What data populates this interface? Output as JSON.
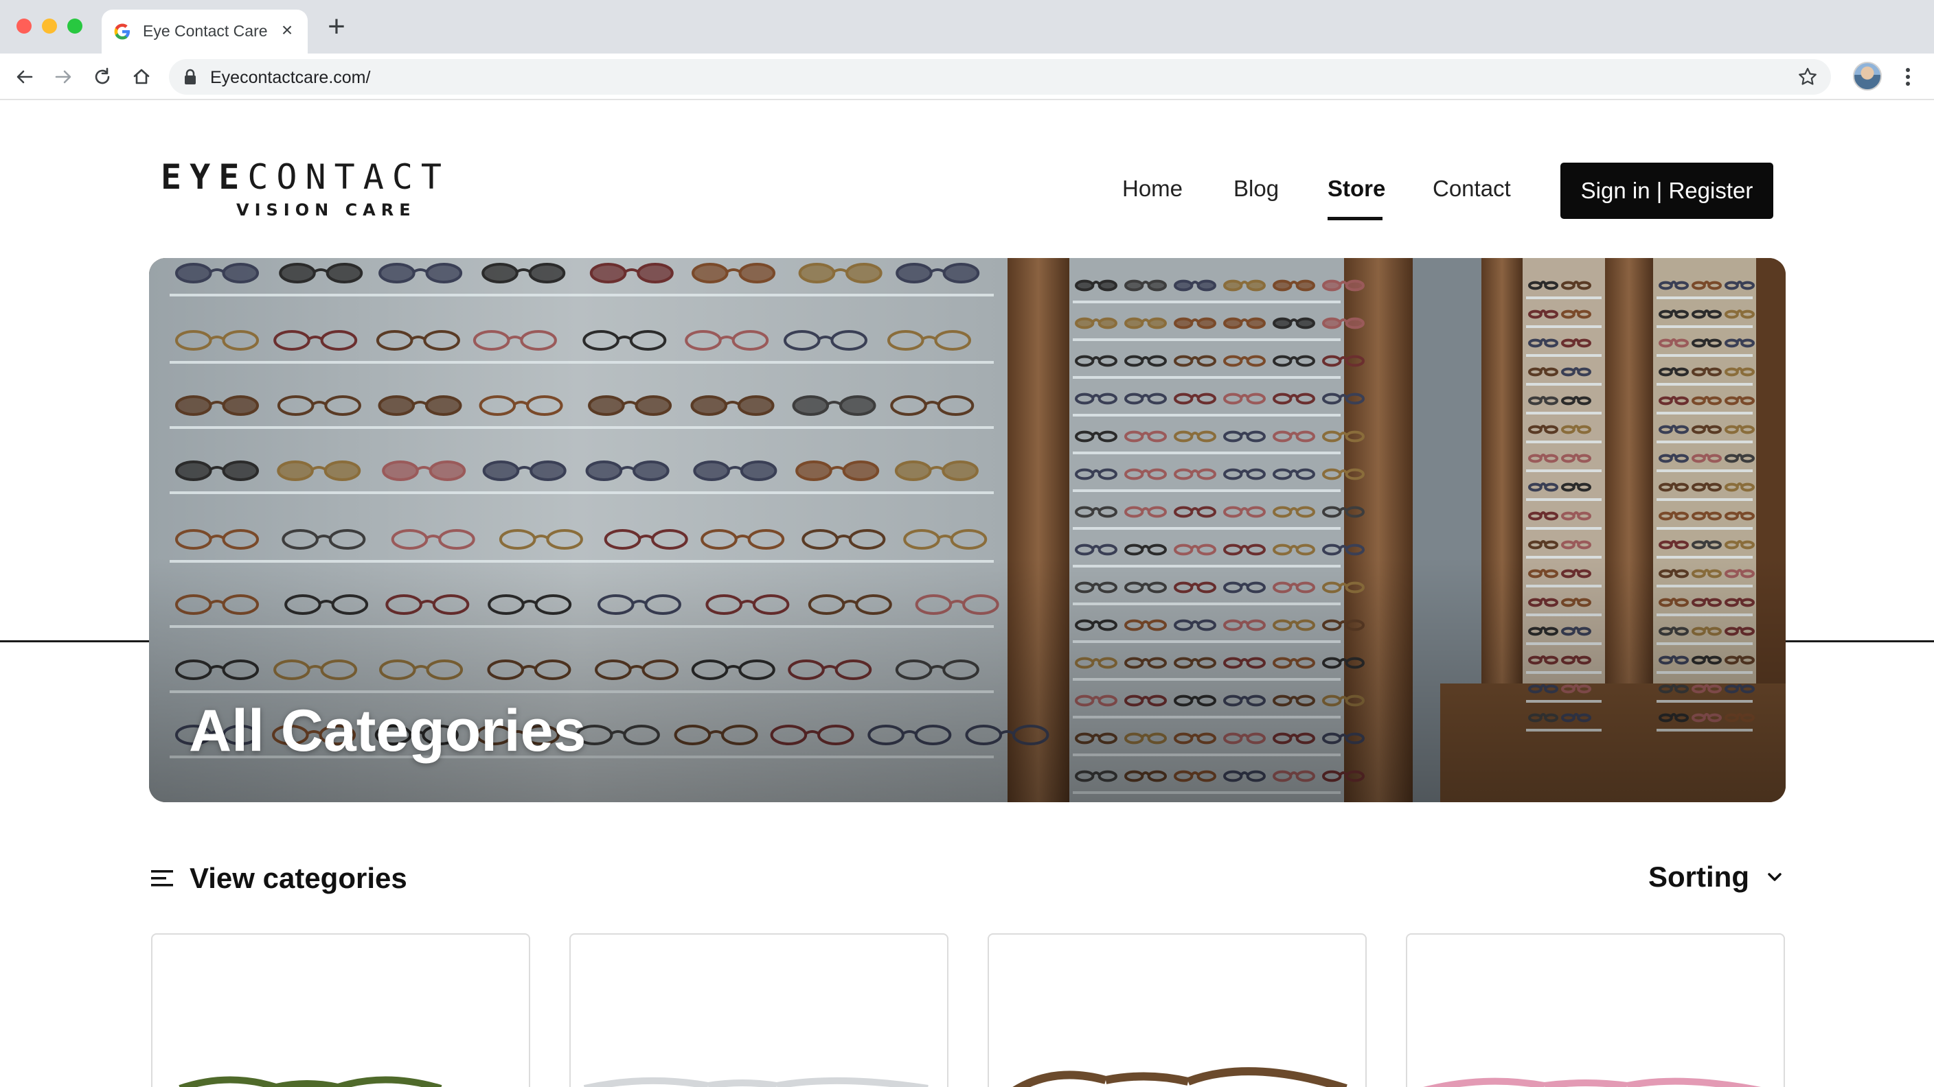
{
  "browser": {
    "tab_title": "Eye Contact Care",
    "tab_close": "×",
    "new_tab": "+",
    "url": "Eyecontactcare.com/"
  },
  "site": {
    "logo": {
      "word1": "EYE",
      "word2": "CONTACT",
      "sub": "VISION CARE"
    },
    "nav": [
      {
        "label": "Home",
        "active": false
      },
      {
        "label": "Blog",
        "active": false
      },
      {
        "label": "Store",
        "active": true
      },
      {
        "label": "Contact",
        "active": false
      }
    ],
    "signin_label": "Sign in | Register"
  },
  "hero": {
    "title": "All Categories"
  },
  "filters": {
    "view_categories": "View categories",
    "sorting": "Sorting"
  },
  "products": [
    {
      "frame_color": "#4f6a2a"
    },
    {
      "frame_color": "#d4d7da"
    },
    {
      "frame_color": "#6b4a2c"
    },
    {
      "frame_color": "#e39ab4"
    }
  ],
  "colors": {
    "accent": "#0b0b0b",
    "chrome": "#dee1e6"
  }
}
